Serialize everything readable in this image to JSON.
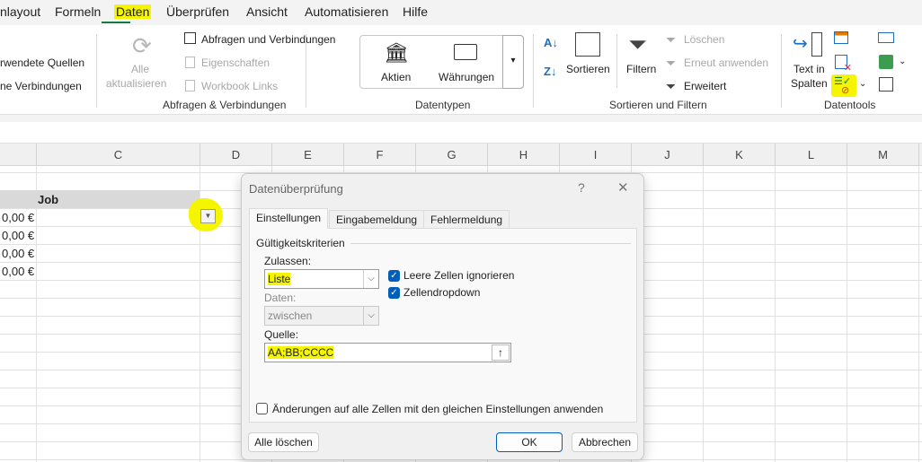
{
  "tabs": [
    "nlayout",
    "Formeln",
    "Daten",
    "Überprüfen",
    "Ansicht",
    "Automatisieren",
    "Hilfe"
  ],
  "active_tab": "Daten",
  "ribbon": {
    "left": {
      "item1": "rwendete Quellen",
      "item2": "ne Verbindungen"
    },
    "queries": {
      "refresh_all_1": "Alle",
      "refresh_all_2": "aktualisieren",
      "queries_connections": "Abfragen und Verbindungen",
      "properties": "Eigenschaften",
      "workbook_links": "Workbook Links",
      "group": "Abfragen & Verbindungen"
    },
    "datatypes": {
      "stocks": "Aktien",
      "currencies": "Währungen",
      "group": "Datentypen"
    },
    "sort": {
      "sort": "Sortieren",
      "filter": "Filtern",
      "clear": "Löschen",
      "reapply": "Erneut anwenden",
      "advanced": "Erweitert",
      "group": "Sortieren und Filtern"
    },
    "tools": {
      "text_to_columns_1": "Text in",
      "text_to_columns_2": "Spalten",
      "group": "Datentools"
    }
  },
  "columns": [
    "C",
    "D",
    "E",
    "F",
    "G",
    "H",
    "I",
    "J",
    "K",
    "L",
    "M"
  ],
  "sheet": {
    "header": "Job",
    "values": [
      "0,00 €",
      "0,00 €",
      "0,00 €",
      "0,00 €"
    ]
  },
  "dialog": {
    "title": "Datenüberprüfung",
    "help": "?",
    "close": "✕",
    "tabs": [
      "Einstellungen",
      "Eingabemeldung",
      "Fehlermeldung"
    ],
    "section": "Gültigkeitskriterien",
    "allow_label": "Zulassen:",
    "allow_value": "Liste",
    "data_label": "Daten:",
    "data_value": "zwischen",
    "ignore_blank": {
      "label": "Leere Zellen ignorieren",
      "checked": true
    },
    "in_cell_dropdown": {
      "label": "Zellendropdown",
      "checked": true
    },
    "source_label": "Quelle:",
    "source_value": "AA;BB;CCCC",
    "apply_all": {
      "label": "Änderungen auf alle Zellen mit den gleichen Einstellungen anwenden",
      "checked": false
    },
    "clear_all": "Alle löschen",
    "ok": "OK",
    "cancel": "Abbrechen"
  },
  "colors": {
    "highlight": "#f5f500",
    "accent": "#005fb8",
    "excel_green": "#107c41"
  }
}
